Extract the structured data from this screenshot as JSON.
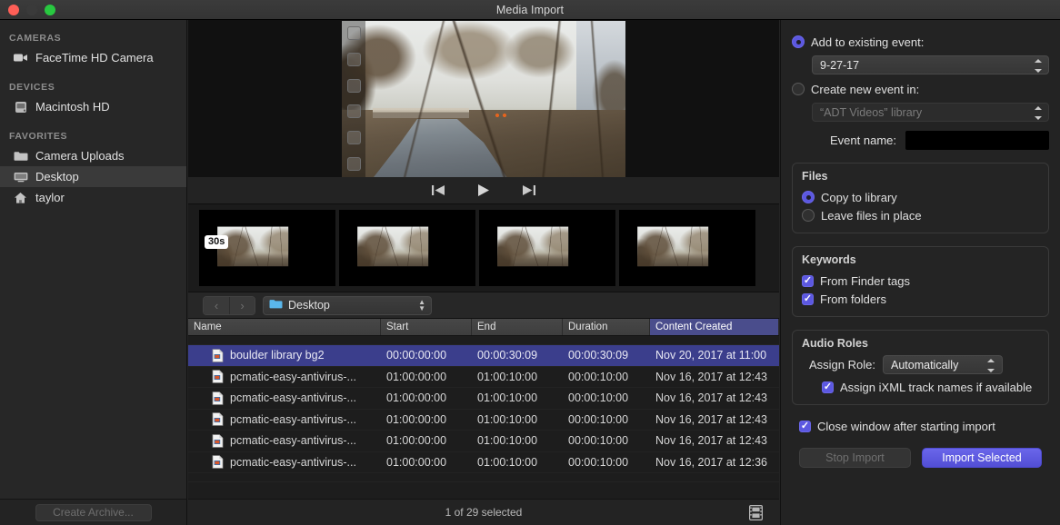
{
  "window": {
    "title": "Media Import"
  },
  "sidebar": {
    "sections": [
      {
        "header": "CAMERAS",
        "items": [
          {
            "label": "FaceTime HD Camera",
            "icon": "camera-icon",
            "selected": false
          }
        ]
      },
      {
        "header": "DEVICES",
        "items": [
          {
            "label": "Macintosh HD",
            "icon": "harddisk-icon",
            "selected": false
          }
        ]
      },
      {
        "header": "FAVORITES",
        "items": [
          {
            "label": "Camera Uploads",
            "icon": "folder-icon",
            "selected": false
          },
          {
            "label": "Desktop",
            "icon": "desktop-icon",
            "selected": true
          },
          {
            "label": "taylor",
            "icon": "home-icon",
            "selected": false
          }
        ]
      }
    ],
    "archive_button": "Create Archive..."
  },
  "preview": {
    "transport": {
      "prev": "skip-back-icon",
      "play": "play-icon",
      "next": "skip-forward-icon"
    },
    "filmstrip_badge": "30s"
  },
  "pathbar": {
    "back": "‹",
    "forward": "›",
    "location": "Desktop",
    "location_icon": "folder-icon"
  },
  "table": {
    "columns": [
      {
        "key": "name",
        "label": "Name",
        "sorted": false
      },
      {
        "key": "start",
        "label": "Start",
        "sorted": false
      },
      {
        "key": "end",
        "label": "End",
        "sorted": false
      },
      {
        "key": "duration",
        "label": "Duration",
        "sorted": false
      },
      {
        "key": "created",
        "label": "Content Created",
        "sorted": true
      }
    ],
    "rows": [
      {
        "name": "",
        "start": "",
        "end": "",
        "duration": "",
        "created": "",
        "selected": false,
        "clipped": true
      },
      {
        "name": "boulder library bg2",
        "start": "00:00:00:00",
        "end": "00:00:30:09",
        "duration": "00:00:30:09",
        "created": "Nov 20, 2017 at 11:00",
        "selected": true,
        "clipped": false
      },
      {
        "name": "pcmatic-easy-antivirus-...",
        "start": "01:00:00:00",
        "end": "01:00:10:00",
        "duration": "00:00:10:00",
        "created": "Nov 16, 2017 at 12:43",
        "selected": false,
        "clipped": false
      },
      {
        "name": "pcmatic-easy-antivirus-...",
        "start": "01:00:00:00",
        "end": "01:00:10:00",
        "duration": "00:00:10:00",
        "created": "Nov 16, 2017 at 12:43",
        "selected": false,
        "clipped": false
      },
      {
        "name": "pcmatic-easy-antivirus-...",
        "start": "01:00:00:00",
        "end": "01:00:10:00",
        "duration": "00:00:10:00",
        "created": "Nov 16, 2017 at 12:43",
        "selected": false,
        "clipped": false
      },
      {
        "name": "pcmatic-easy-antivirus-...",
        "start": "01:00:00:00",
        "end": "01:00:10:00",
        "duration": "00:00:10:00",
        "created": "Nov 16, 2017 at 12:43",
        "selected": false,
        "clipped": false
      },
      {
        "name": "pcmatic-easy-antivirus-...",
        "start": "01:00:00:00",
        "end": "01:00:10:00",
        "duration": "00:00:10:00",
        "created": "Nov 16, 2017 at 12:36",
        "selected": false,
        "clipped": false
      },
      {
        "name": "",
        "start": "",
        "end": "",
        "duration": "",
        "created": "",
        "selected": false,
        "clipped": true
      }
    ],
    "status": "1 of 29 selected",
    "view_icon": "filmstrip-icon"
  },
  "inspector": {
    "add_existing": {
      "label": "Add to existing event:",
      "selected": true,
      "value": "9-27-17"
    },
    "create_new": {
      "label": "Create new event in:",
      "selected": false,
      "value": "“ADT Videos” library"
    },
    "event_name": {
      "label": "Event name:",
      "value": ""
    },
    "files": {
      "title": "Files",
      "options": [
        {
          "label": "Copy to library",
          "selected": true
        },
        {
          "label": "Leave files in place",
          "selected": false
        }
      ]
    },
    "keywords": {
      "title": "Keywords",
      "options": [
        {
          "label": "From Finder tags",
          "checked": true
        },
        {
          "label": "From folders",
          "checked": true
        }
      ]
    },
    "audio_roles": {
      "title": "Audio Roles",
      "assign_label": "Assign Role:",
      "assign_value": "Automatically",
      "ixml": {
        "label": "Assign iXML track names if available",
        "checked": true
      }
    },
    "close_window": {
      "label": "Close window after starting import",
      "checked": true
    },
    "buttons": {
      "stop": "Stop Import",
      "import": "Import Selected"
    }
  },
  "colors": {
    "accent": "#5c58e0",
    "selection": "#3b3e8c",
    "header_sorted": "#4a4d8c"
  }
}
